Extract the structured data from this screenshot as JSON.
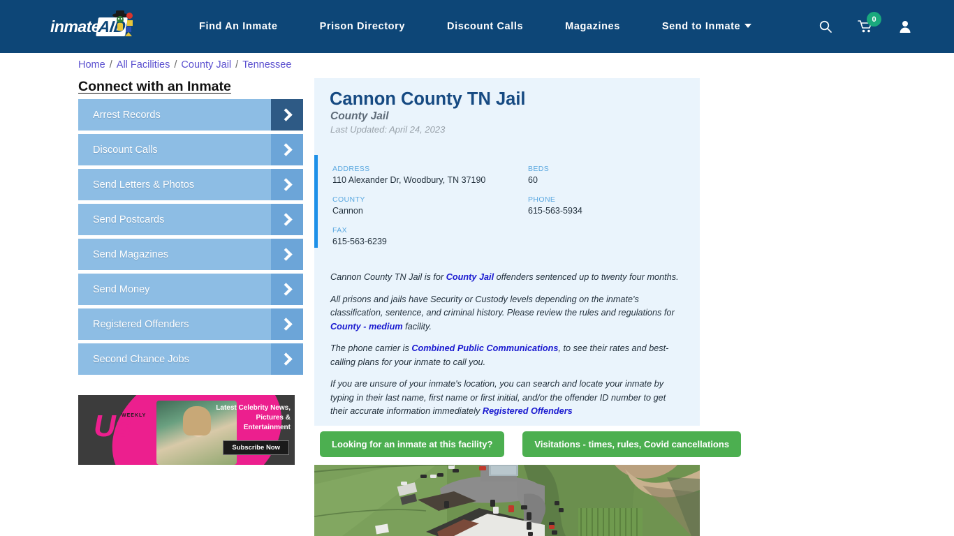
{
  "header": {
    "logo_text": "inmate",
    "logo_accent": "AID",
    "nav": [
      {
        "label": "Find An Inmate",
        "name": "nav-find-an-inmate"
      },
      {
        "label": "Prison Directory",
        "name": "nav-prison-directory"
      },
      {
        "label": "Discount Calls",
        "name": "nav-discount-calls"
      },
      {
        "label": "Magazines",
        "name": "nav-magazines"
      },
      {
        "label": "Send to Inmate",
        "name": "nav-send-to-inmate",
        "has_caret": true
      }
    ],
    "icons": {
      "search": "search-icon",
      "cart": "cart-icon",
      "cart_count": "0",
      "account": "user-account-icon"
    },
    "colors": {
      "background": "#0d4677",
      "cart_badge": "#1aa97d"
    }
  },
  "breadcrumb": {
    "items": [
      "Home",
      "All Facilities",
      "County Jail",
      "Tennessee"
    ],
    "separator": "/"
  },
  "sidebar": {
    "title": "Connect with an Inmate",
    "items": [
      {
        "label": "Arrest Records",
        "active": true
      },
      {
        "label": "Discount Calls",
        "active": false
      },
      {
        "label": "Send Letters & Photos",
        "active": false
      },
      {
        "label": "Send Postcards",
        "active": false
      },
      {
        "label": "Send Magazines",
        "active": false
      },
      {
        "label": "Send Money",
        "active": false
      },
      {
        "label": "Registered Offenders",
        "active": false
      },
      {
        "label": "Second Chance Jobs",
        "active": false
      }
    ]
  },
  "ad": {
    "brand": "Us",
    "brand_sub": "WEEKLY",
    "copy": "Latest Celebrity News, Pictures & Entertainment",
    "cta": "Subscribe Now"
  },
  "facility": {
    "title": "Cannon County TN Jail",
    "subtitle": "County Jail",
    "last_updated": "Last Updated: April 24, 2023",
    "details": [
      {
        "key": "ADDRESS",
        "value": "110 Alexander Dr, Woodbury, TN 37190"
      },
      {
        "key": "BEDS",
        "value": "60"
      },
      {
        "key": "COUNTY",
        "value": "Cannon"
      },
      {
        "key": "PHONE",
        "value": "615-563-5934"
      },
      {
        "key": "FAX",
        "value": "615-563-6239"
      }
    ],
    "paragraphs": [
      {
        "parts": [
          {
            "t": "Cannon County TN Jail is for ",
            "link": false
          },
          {
            "t": "County Jail",
            "link": true
          },
          {
            "t": " offenders sentenced up to twenty four months.",
            "link": false
          }
        ]
      },
      {
        "parts": [
          {
            "t": "All prisons and jails have Security or Custody levels depending on the inmate's classification, sentence, and criminal history. Please review the rules and regulations for ",
            "link": false
          },
          {
            "t": "County - medium",
            "link": true
          },
          {
            "t": " facility.",
            "link": false
          }
        ]
      },
      {
        "parts": [
          {
            "t": "The phone carrier is ",
            "link": false
          },
          {
            "t": "Combined Public Communications",
            "link": true
          },
          {
            "t": ", to see their rates and best-calling plans for your inmate to call you.",
            "link": false
          }
        ]
      },
      {
        "parts": [
          {
            "t": "If you are unsure of your inmate's location, you can search and locate your inmate by typing in their last name, first name or first initial, and/or the offender ID number to get their accurate information immediately ",
            "link": false
          },
          {
            "t": "Registered Offenders",
            "link": true
          }
        ]
      }
    ],
    "cta_buttons": [
      "Looking for an inmate at this facility?",
      "Visitations - times, rules, Covid cancellations"
    ]
  },
  "colors": {
    "panel_bg": "#eaf4fc",
    "accent_bar": "#1e90e8",
    "cta_green": "#4caf50",
    "link_blue": "#1a1ad0",
    "title_blue": "#164a82",
    "sidebar_btn": "#8dbde4",
    "sidebar_arrow": "#6ca5d8",
    "sidebar_arrow_active": "#2e5a85"
  }
}
